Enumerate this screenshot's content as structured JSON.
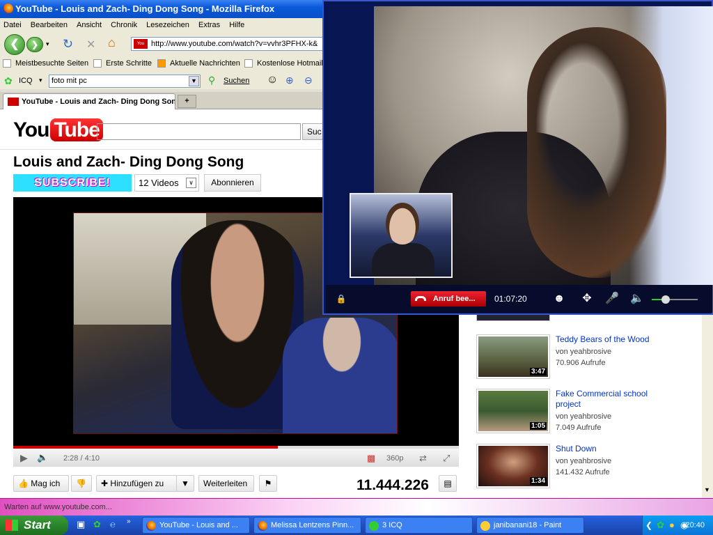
{
  "firefox": {
    "title": "YouTube - Louis and Zach- Ding Dong Song - Mozilla Firefox",
    "menu": [
      "Datei",
      "Bearbeiten",
      "Ansicht",
      "Chronik",
      "Lesezeichen",
      "Extras",
      "Hilfe"
    ],
    "url": "http://www.youtube.com/watch?v=vvhr3PFHX-k&",
    "bookmarks": [
      "Meistbesuchte Seiten",
      "Erste Schritte",
      "Aktuelle Nachrichten",
      "Kostenlose Hotmail"
    ],
    "icq_label": "ICQ",
    "search_value": "foto mit pc",
    "search_label": "Suchen",
    "tab_title": "YouTube - Louis and Zach- Ding Dong Song",
    "new_tab": "+",
    "status": "Warten auf www.youtube.com..."
  },
  "youtube": {
    "logo_you": "You",
    "logo_tube": "Tube",
    "search_button": "Suc",
    "video_title": "Louis and Zach- Ding Dong Song",
    "subscribe_banner": "SUBSCRIBE!",
    "video_count": "12 Videos",
    "subscribe_button": "Abonnieren",
    "time": "2:28 / 4:10",
    "quality": "360p",
    "like": "Mag ich",
    "add_to": "Hinzufügen zu",
    "share": "Weiterleiten",
    "views": "11.444.226",
    "progress_fraction": 0.593,
    "related": [
      {
        "title": "Teddy Bears of the Wood",
        "author": "von yeahbrosive",
        "views": "70.906 Aufrufe",
        "duration": "3:47"
      },
      {
        "title": "Fake Commercial school project",
        "author": "von yeahbrosive",
        "views": "7.049 Aufrufe",
        "duration": "1:05"
      },
      {
        "title": "Shut Down",
        "author": "von yeahbrosive",
        "views": "141.432 Aufrufe",
        "duration": "1:34"
      }
    ]
  },
  "videocall": {
    "end_call": "Anruf bee...",
    "timer": "01:07:20",
    "volume_fraction": 0.3
  },
  "taskbar": {
    "start": "Start",
    "items": [
      "YouTube - Louis and ...",
      "Melissa Lentzens Pinn...",
      "3 ICQ",
      "janibanani18 - Paint"
    ],
    "clock": "20:40"
  }
}
